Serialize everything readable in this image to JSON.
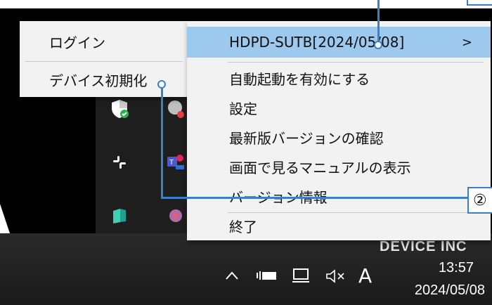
{
  "left_menu": {
    "items": [
      {
        "label": "ログイン"
      },
      {
        "label": "デバイス初期化"
      }
    ]
  },
  "main_menu": {
    "header": "HDPD-SUTB[2024/05/08]",
    "submenu_arrow": ">",
    "items": [
      {
        "label": "自動起動を有効にする"
      },
      {
        "label": "設定"
      },
      {
        "label": "最新版バージョンの確認"
      },
      {
        "label": "画面で見るマニュアルの表示"
      },
      {
        "label": "バージョン情報"
      },
      {
        "label": "終了"
      }
    ]
  },
  "callouts": [
    {
      "label": "②"
    }
  ],
  "taskbar": {
    "partial_text": "DEVICE INC",
    "ime_indicator": "A",
    "time": "13:57",
    "date": "2024/05/08",
    "icons": [
      "chevron-up-icon",
      "battery-icon",
      "network-icon",
      "volume-muted-icon"
    ]
  },
  "colors": {
    "menu_bg": "#f2f2f2",
    "highlight": "#9ec9ee",
    "callout": "#3a7fc8",
    "taskbar": "#1c1c1c"
  }
}
